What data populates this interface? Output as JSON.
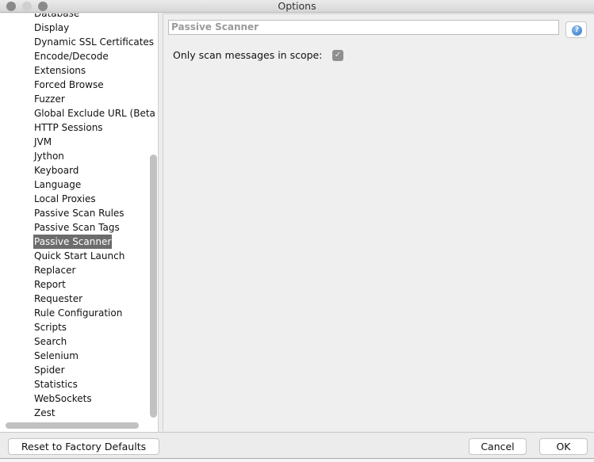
{
  "window": {
    "title": "Options"
  },
  "tree": {
    "items": [
      "Database",
      "Display",
      "Dynamic SSL Certificates",
      "Encode/Decode",
      "Extensions",
      "Forced Browse",
      "Fuzzer",
      "Global Exclude URL (Beta",
      "HTTP Sessions",
      "JVM",
      "Jython",
      "Keyboard",
      "Language",
      "Local Proxies",
      "Passive Scan Rules",
      "Passive Scan Tags",
      "Passive Scanner",
      "Quick Start Launch",
      "Replacer",
      "Report",
      "Requester",
      "Rule Configuration",
      "Scripts",
      "Search",
      "Selenium",
      "Spider",
      "Statistics",
      "WebSockets",
      "Zest"
    ],
    "selected": "Passive Scanner"
  },
  "panel": {
    "heading": "Passive Scanner",
    "help_icon": "help-icon",
    "scope_label": "Only scan messages in scope:",
    "scope_checked": true
  },
  "footer": {
    "reset_label": "Reset to Factory Defaults",
    "cancel_label": "Cancel",
    "ok_label": "OK"
  },
  "colors": {
    "selection": "#6c6c6c",
    "panel_bg": "#efefef"
  }
}
